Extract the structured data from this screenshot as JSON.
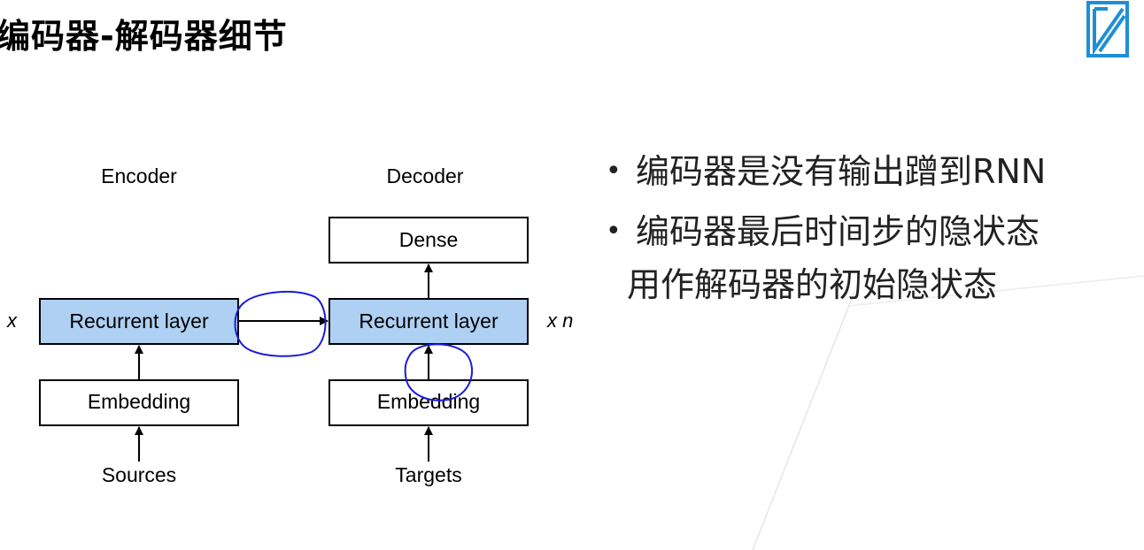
{
  "slide": {
    "title": "编码器-解码器细节"
  },
  "diagram": {
    "encoder": {
      "heading": "Encoder",
      "recurrent_label": "Recurrent layer",
      "embedding_label": "Embedding",
      "input_label": "Sources",
      "repeat_marker": "x"
    },
    "decoder": {
      "heading": "Decoder",
      "dense_label": "Dense",
      "recurrent_label": "Recurrent layer",
      "embedding_label": "Embedding",
      "input_label": "Targets",
      "repeat_marker": "x n"
    }
  },
  "bullets": [
    {
      "text": "编码器是没有输出蹭到RNN",
      "cont": ""
    },
    {
      "text": "编码器最后时间步的隐状态",
      "cont": "用作解码器的初始隐状态"
    }
  ],
  "colors": {
    "recurrent_fill": "#aed0f2",
    "box_stroke": "#000000",
    "annotation_ink": "#1c1cd6",
    "logo_blue": "#1e8fd6"
  },
  "icons": {
    "logo": "brand-logo-icon"
  }
}
